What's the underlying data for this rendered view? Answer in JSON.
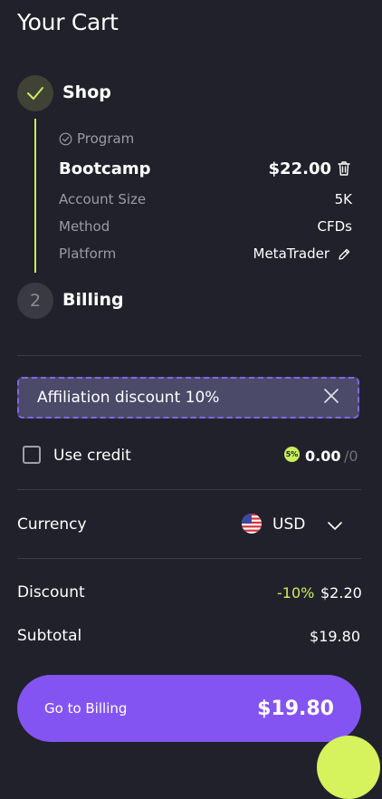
{
  "page": {
    "title": "Your Cart"
  },
  "steps": [
    {
      "number": "1",
      "label": "Shop",
      "status": "complete"
    },
    {
      "number": "2",
      "label": "Billing",
      "status": "pending"
    }
  ],
  "program": {
    "tag": "Program",
    "name": "Bootcamp",
    "price": "$22.00",
    "details": [
      {
        "label": "Account Size",
        "value": "5K"
      },
      {
        "label": "Method",
        "value": "CFDs"
      },
      {
        "label": "Platform",
        "value": "MetaTrader"
      }
    ]
  },
  "affiliation": {
    "text": "Affiliation discount 10%"
  },
  "credit": {
    "label": "Use credit",
    "amount": "0.00",
    "max": "/0",
    "badge": "5%"
  },
  "currency": {
    "label": "Currency",
    "value": "USD"
  },
  "summary": {
    "discount_label": "Discount",
    "discount_percent": "-10%",
    "discount_amount": "$2.20",
    "subtotal_label": "Subtotal",
    "subtotal_amount": "$19.80"
  },
  "cta": {
    "label": "Go to Billing",
    "amount": "$19.80"
  },
  "colors": {
    "accent_green": "#c9ee5d",
    "accent_purple": "#8454f3",
    "background": "#21212b"
  }
}
